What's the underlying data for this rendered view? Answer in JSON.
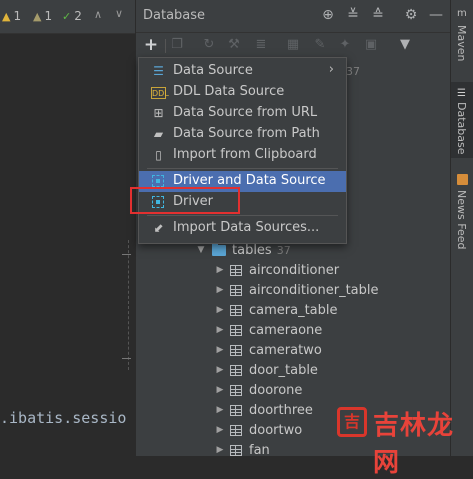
{
  "editor": {
    "inspections": [
      {
        "icon": "warning-icon",
        "count": "1"
      },
      {
        "icon": "weak-warning-icon",
        "count": "1"
      },
      {
        "icon": "check-icon",
        "count": "2"
      }
    ],
    "code_fragment": ".ibatis.sessio"
  },
  "database_panel": {
    "title": "Database",
    "header_icons": [
      "target-icon",
      "expand-all-icon",
      "collapse-all-icon",
      "settings-icon",
      "hide-icon"
    ],
    "toolbar_icons": [
      "add-icon",
      "copy-icon",
      "refresh-icon",
      "properties-icon",
      "schema-icon",
      "table-icon",
      "edit-icon",
      "jump-icon",
      "console-icon",
      "filter-icon"
    ],
    "behind_popup_count": "37",
    "tree": {
      "folder": {
        "label": "tables",
        "count": "37"
      },
      "tables": [
        "airconditioner",
        "airconditioner_table",
        "camera_table",
        "cameraone",
        "cameratwo",
        "door_table",
        "doorone",
        "doorthree",
        "doortwo",
        "fan"
      ]
    }
  },
  "popup_menu": {
    "items": [
      {
        "icon": "data-source-icon",
        "label": "Data Source",
        "submenu": "›"
      },
      {
        "icon": "ddl-icon",
        "label": "DDL Data Source"
      },
      {
        "icon": "url-icon",
        "label": "Data Source from URL"
      },
      {
        "icon": "folder-icon",
        "label": "Data Source from Path"
      },
      {
        "icon": "clipboard-icon",
        "label": "Import from Clipboard"
      },
      {
        "icon": "driver-icon",
        "label": "Driver and Data Source",
        "selected": true
      },
      {
        "icon": "driver-icon",
        "label": "Driver"
      },
      {
        "icon": "import-icon",
        "label": "Import Data Sources..."
      }
    ]
  },
  "right_stripe": {
    "tabs": [
      {
        "label": "Maven",
        "icon": "maven-icon"
      },
      {
        "label": "Database",
        "icon": "database-icon",
        "active": true
      },
      {
        "label": "News Feed",
        "icon": "news-icon"
      }
    ]
  },
  "watermark": {
    "text": "吉林龙网"
  }
}
